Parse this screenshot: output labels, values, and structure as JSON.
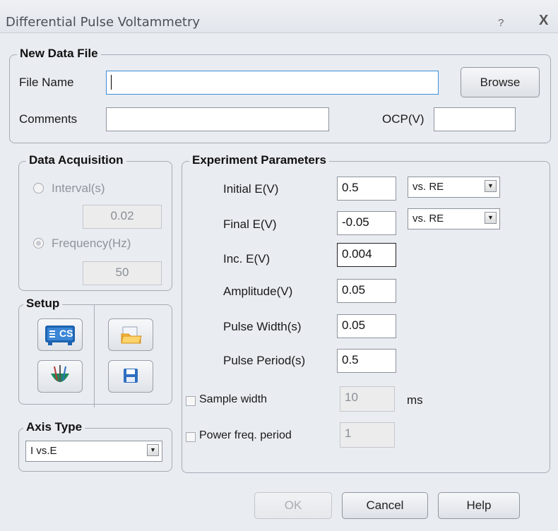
{
  "window": {
    "title": "Differential Pulse Voltammetry",
    "help_glyph": "?",
    "close_glyph": "X"
  },
  "new_data_file": {
    "legend": "New Data File",
    "file_name_label": "File Name",
    "file_name_value": "",
    "browse_label": "Browse",
    "comments_label": "Comments",
    "comments_value": "",
    "ocp_label": "OCP(V)",
    "ocp_value": ""
  },
  "data_acquisition": {
    "legend": "Data Acquisition",
    "interval_label": "Interval(s)",
    "interval_value": "0.02",
    "frequency_label": "Frequency(Hz)",
    "frequency_value": "50"
  },
  "setup": {
    "legend": "Setup",
    "buttons": [
      "cs-instrument-icon",
      "open-folder-icon",
      "electrode-icon",
      "save-disk-icon"
    ],
    "cs_text": "CS"
  },
  "axis_type": {
    "legend": "Axis Type",
    "selected": "I vs.E"
  },
  "experiment": {
    "legend": "Experiment Parameters",
    "initial_label": "Initial E(V)",
    "initial_value": "0.5",
    "initial_ref": "vs. RE",
    "final_label": "Final E(V)",
    "final_value": "-0.05",
    "final_ref": "vs. RE",
    "inc_label": "Inc. E(V)",
    "inc_value": "0.004",
    "amplitude_label": "Amplitude(V)",
    "amplitude_value": "0.05",
    "pulse_width_label": "Pulse Width(s)",
    "pulse_width_value": "0.05",
    "pulse_period_label": "Pulse Period(s)",
    "pulse_period_value": "0.5",
    "sample_width_label": "Sample width",
    "sample_width_value": "10",
    "sample_width_unit": "ms",
    "power_freq_label": "Power freq. period",
    "power_freq_value": "1"
  },
  "footer": {
    "ok_label": "OK",
    "cancel_label": "Cancel",
    "help_label": "Help"
  }
}
